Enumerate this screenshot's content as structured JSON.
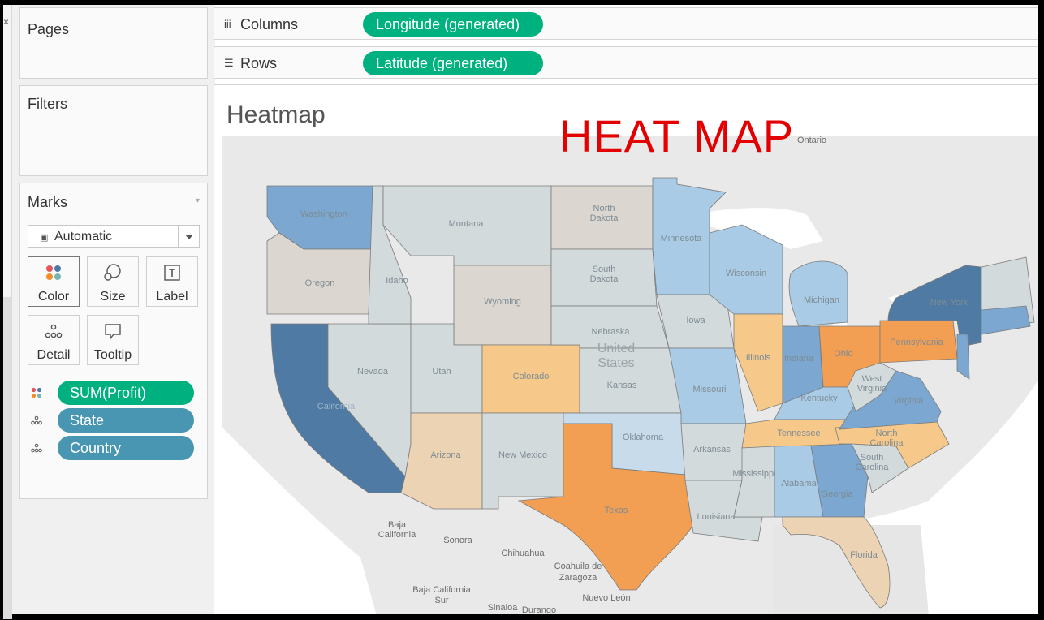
{
  "left_strip": {
    "close_glyph": "×"
  },
  "cards": {
    "pages": "Pages",
    "filters": "Filters",
    "marks": "Marks"
  },
  "marks": {
    "mark_type": "Automatic",
    "buttons": {
      "color": "Color",
      "size": "Size",
      "label": "Label",
      "detail": "Detail",
      "tooltip": "Tooltip"
    },
    "pills": {
      "profit": "SUM(Profit)",
      "state": "State",
      "country": "Country"
    }
  },
  "shelves": {
    "columns": {
      "name": "Columns",
      "pill": "Longitude (generated)"
    },
    "rows": {
      "name": "Rows",
      "pill": "Latitude (generated)"
    }
  },
  "viz": {
    "title": "Heatmap",
    "annotation": "HEAT MAP"
  },
  "map": {
    "state_labels": {
      "washington": "Washington",
      "oregon": "Oregon",
      "california": "California",
      "nevada": "Nevada",
      "idaho": "Idaho",
      "montana": "Montana",
      "wyoming": "Wyoming",
      "utah": "Utah",
      "arizona": "Arizona",
      "colorado": "Colorado",
      "new_mexico": "New Mexico",
      "north_dakota_1": "North",
      "north_dakota_2": "Dakota",
      "south_dakota_1": "South",
      "south_dakota_2": "Dakota",
      "nebraska": "Nebraska",
      "kansas": "Kansas",
      "oklahoma": "Oklahoma",
      "texas": "Texas",
      "minnesota": "Minnesota",
      "iowa": "Iowa",
      "missouri": "Missouri",
      "arkansas": "Arkansas",
      "louisiana": "Louisiana",
      "wisconsin": "Wisconsin",
      "illinois": "Illinois",
      "michigan": "Michigan",
      "indiana": "Indiana",
      "ohio": "Ohio",
      "kentucky": "Kentucky",
      "tennessee": "Tennessee",
      "mississippi": "Mississippi",
      "alabama": "Alabama",
      "georgia": "Georgia",
      "florida": "Florida",
      "south_carolina_1": "South",
      "south_carolina_2": "Carolina",
      "north_carolina_1": "North",
      "north_carolina_2": "Carolina",
      "virginia": "Virginia",
      "west_virginia_1": "West",
      "west_virginia_2": "Virginia",
      "pennsylvania": "Pennsylvania",
      "new_york": "New York"
    },
    "place_labels": {
      "united_states_1": "United",
      "united_states_2": "States",
      "ontario": "Ontario",
      "baja_california_1": "Baja",
      "baja_california_2": "California",
      "sonora": "Sonora",
      "chihuahua": "Chihuahua",
      "coahuila_1": "Coahuila de",
      "coahuila_2": "Zaragoza",
      "baja_california_sur_1": "Baja California",
      "baja_california_sur_2": "Sur",
      "sinaloa": "Sinaloa",
      "durango": "Durango",
      "nuevo_leon": "Nuevo León"
    },
    "colors": {
      "dark_blue": "#4e7aa3",
      "mid_blue": "#7ba7d0",
      "light_blue": "#a9cbe5",
      "pale_blue": "#c7dbea",
      "neutral_gray": "#d3dadb",
      "warm_gray": "#dbd6cf",
      "light_orange": "#f6c98b",
      "pale_orange": "#ecd3b3",
      "orange": "#f29f53",
      "land": "#e8e8e8",
      "water": "#ffffff"
    }
  }
}
